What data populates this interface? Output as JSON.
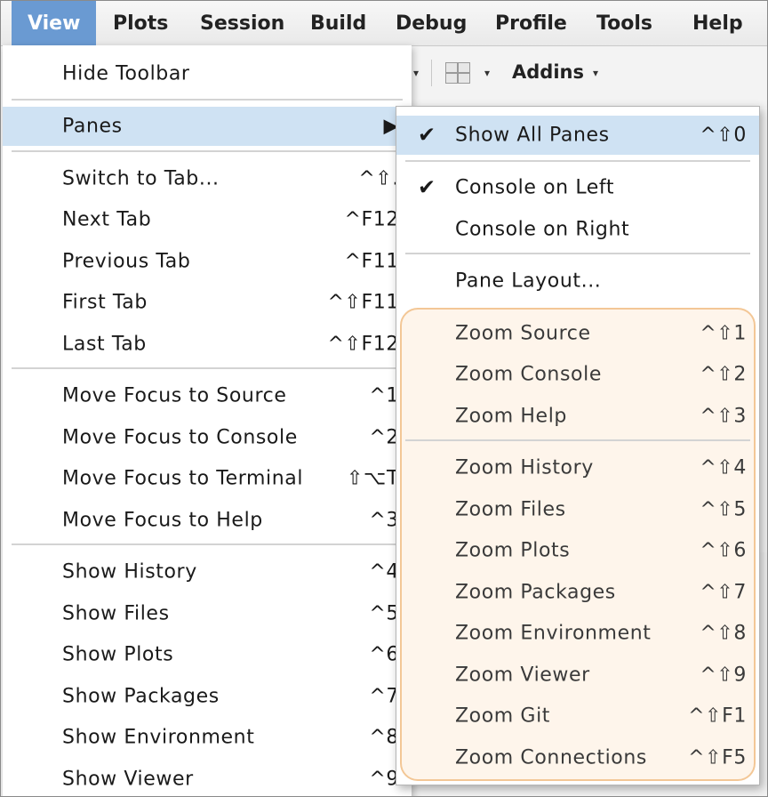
{
  "menubar": {
    "items": [
      {
        "label": "View",
        "active": true
      },
      {
        "label": "Plots"
      },
      {
        "label": "Session"
      },
      {
        "label": "Build"
      },
      {
        "label": "Debug"
      },
      {
        "label": "Profile"
      },
      {
        "label": "Tools"
      },
      {
        "label": "Help"
      }
    ]
  },
  "toolbar": {
    "addins_label": "Addins",
    "dropdown_arrow": "▾",
    "grid_icon": "pane-layout-icon"
  },
  "view_menu": {
    "items": [
      {
        "label": "Hide Toolbar",
        "shortcut": ""
      },
      {
        "label": "Panes",
        "shortcut": "▶",
        "highlighted": true
      },
      {
        "label": "Switch to Tab...",
        "shortcut": "^⇧."
      },
      {
        "label": "Next Tab",
        "shortcut": "^F12"
      },
      {
        "label": "Previous Tab",
        "shortcut": "^F11"
      },
      {
        "label": "First Tab",
        "shortcut": "^⇧F11"
      },
      {
        "label": "Last Tab",
        "shortcut": "^⇧F12"
      },
      {
        "label": "Move Focus to Source",
        "shortcut": "^1"
      },
      {
        "label": "Move Focus to Console",
        "shortcut": "^2"
      },
      {
        "label": "Move Focus to Terminal",
        "shortcut": "⇧⌥T"
      },
      {
        "label": "Move Focus to Help",
        "shortcut": "^3"
      },
      {
        "label": "Show History",
        "shortcut": "^4"
      },
      {
        "label": "Show Files",
        "shortcut": "^5"
      },
      {
        "label": "Show Plots",
        "shortcut": "^6"
      },
      {
        "label": "Show Packages",
        "shortcut": "^7"
      },
      {
        "label": "Show Environment",
        "shortcut": "^8"
      },
      {
        "label": "Show Viewer",
        "shortcut": "^9"
      }
    ]
  },
  "panes_submenu": {
    "check_mark": "✔",
    "items": [
      {
        "label": "Show All Panes",
        "shortcut": "^⇧0",
        "checked": true,
        "highlighted": true
      },
      {
        "label": "Console on Left",
        "shortcut": "",
        "checked": true
      },
      {
        "label": "Console on Right",
        "shortcut": ""
      },
      {
        "label": "Pane Layout...",
        "shortcut": ""
      },
      {
        "label": "Zoom Source",
        "shortcut": "^⇧1"
      },
      {
        "label": "Zoom Console",
        "shortcut": "^⇧2"
      },
      {
        "label": "Zoom Help",
        "shortcut": "^⇧3"
      },
      {
        "label": "Zoom History",
        "shortcut": "^⇧4"
      },
      {
        "label": "Zoom Files",
        "shortcut": "^⇧5"
      },
      {
        "label": "Zoom Plots",
        "shortcut": "^⇧6"
      },
      {
        "label": "Zoom Packages",
        "shortcut": "^⇧7"
      },
      {
        "label": "Zoom Environment",
        "shortcut": "^⇧8"
      },
      {
        "label": "Zoom Viewer",
        "shortcut": "^⇧9"
      },
      {
        "label": "Zoom Git",
        "shortcut": "^⇧F1"
      },
      {
        "label": "Zoom Connections",
        "shortcut": "^⇧F5"
      }
    ]
  },
  "colors": {
    "menubar_active": "#6a9ad2",
    "menu_highlight": "#cfe2f3",
    "zoom_group_border": "#f3c796",
    "zoom_group_fill": "#fdedda"
  }
}
